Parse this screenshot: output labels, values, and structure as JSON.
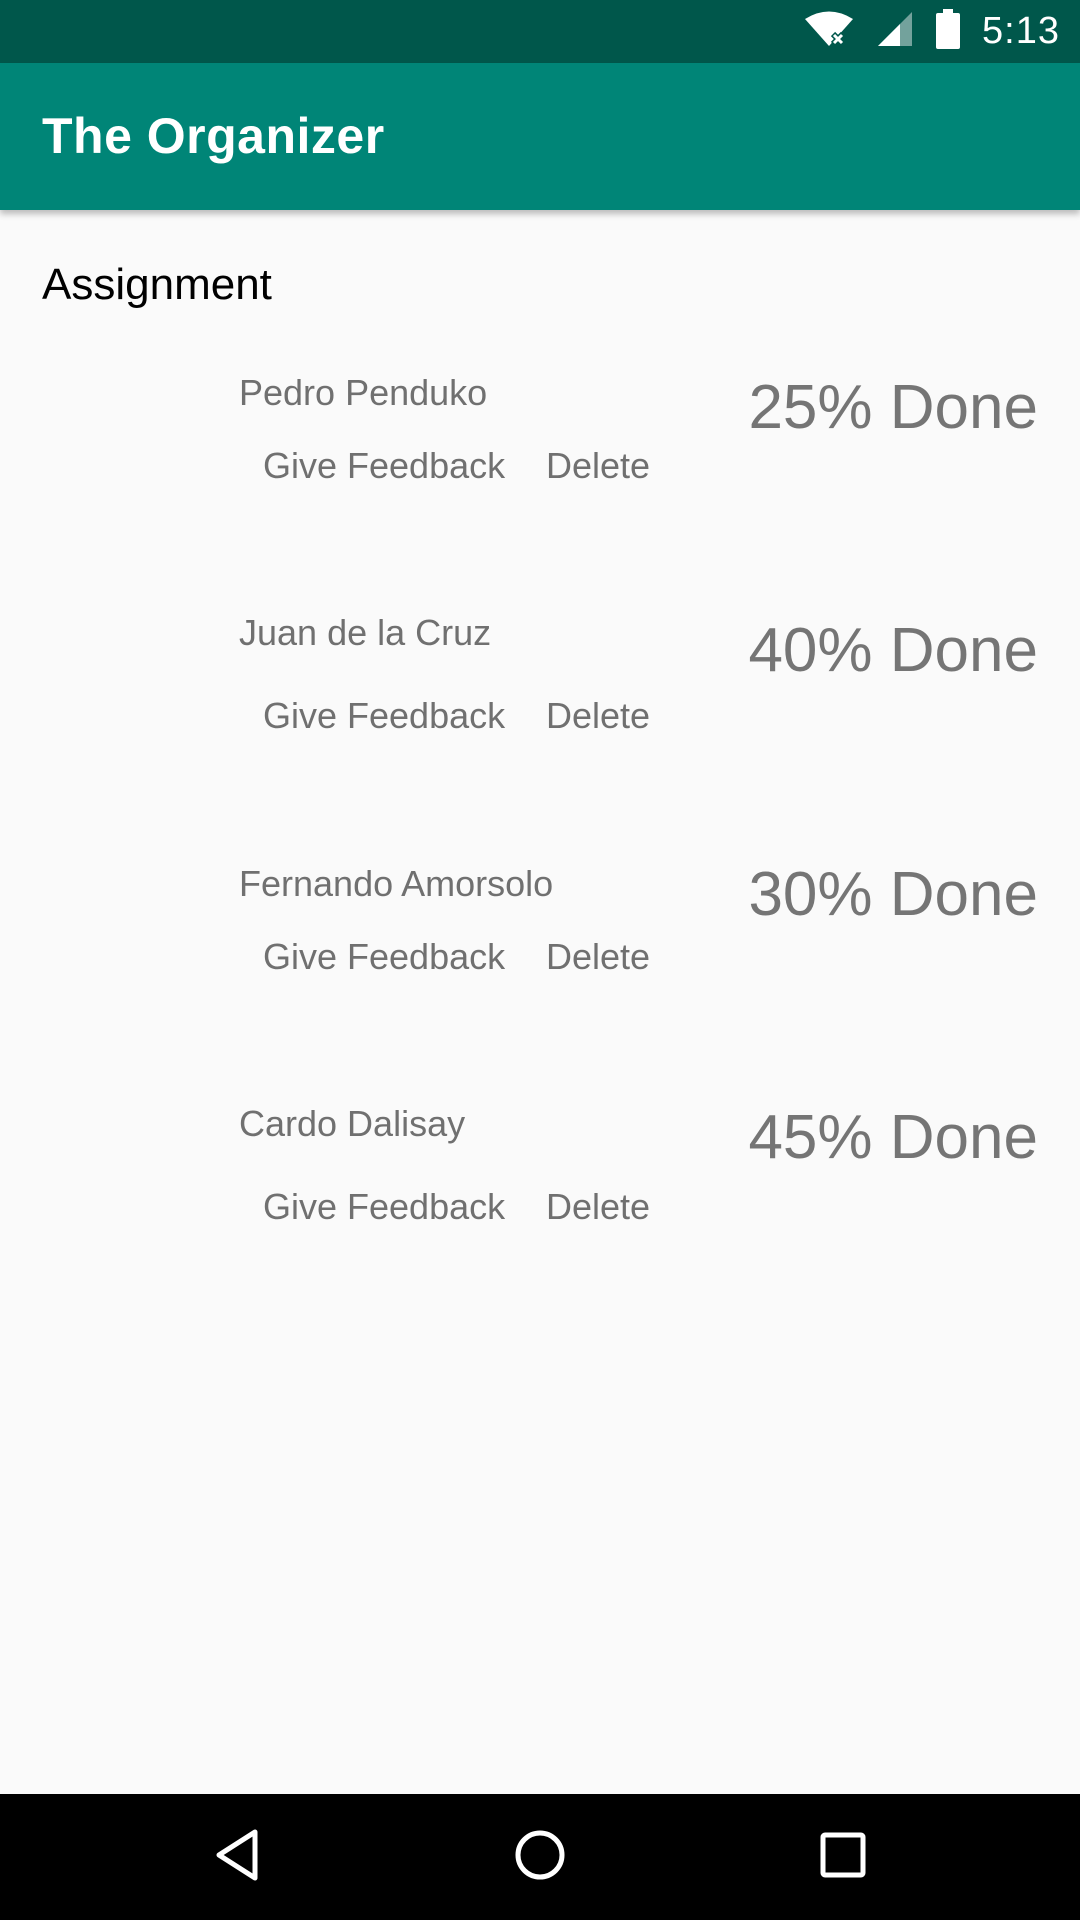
{
  "status_bar": {
    "time": "5:13",
    "icons": [
      "wifi-icon",
      "signal-icon",
      "battery-icon"
    ]
  },
  "app_bar": {
    "title": "The Organizer",
    "color": "#008577"
  },
  "section": {
    "title": "Assignment"
  },
  "items": [
    {
      "name": "Pedro Penduko",
      "feedback_label": "Give Feedback",
      "delete_label": "Delete",
      "progress": "25% Done"
    },
    {
      "name": "Juan de la Cruz",
      "feedback_label": "Give Feedback",
      "delete_label": "Delete",
      "progress": "40% Done"
    },
    {
      "name": "Fernando Amorsolo",
      "feedback_label": "Give Feedback",
      "delete_label": "Delete",
      "progress": "30% Done"
    },
    {
      "name": "Cardo Dalisay",
      "feedback_label": "Give Feedback",
      "delete_label": "Delete",
      "progress": "45% Done"
    }
  ],
  "nav_bar": {
    "icons": [
      "back-icon",
      "home-icon",
      "recents-icon"
    ]
  },
  "colors": {
    "status_bar": "#00574b",
    "app_bar": "#008577",
    "background": "#fafafa",
    "text_secondary": "#757575"
  }
}
